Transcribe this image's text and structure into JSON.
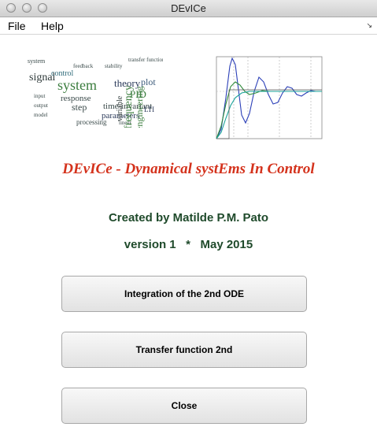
{
  "window": {
    "title": "DEvICe"
  },
  "menu": {
    "items": [
      {
        "label": "File"
      },
      {
        "label": "Help"
      }
    ]
  },
  "wordcloud": {
    "words": [
      "signal",
      "system",
      "control",
      "theory",
      "plot",
      "PID",
      "parameters",
      "time-invariant",
      "processing",
      "response",
      "frequency",
      "engineering",
      "LTI",
      "step",
      "variable",
      "output",
      "input",
      "feedback",
      "model",
      "stability"
    ]
  },
  "main": {
    "heading": "DEvICe - Dynamical systEms In Control",
    "author": "Created by Matilde P.M. Pato",
    "version": "version 1   *   May 2015"
  },
  "buttons": [
    {
      "label": "Integration of the 2nd ODE"
    },
    {
      "label": "Transfer function 2nd"
    },
    {
      "label": "Close"
    }
  ],
  "colors": {
    "heading": "#d4321c",
    "text": "#1f4a2b",
    "curve_blue": "#2b3fb8",
    "curve_green": "#2e8b3a",
    "curve_teal": "#1aa39a"
  }
}
